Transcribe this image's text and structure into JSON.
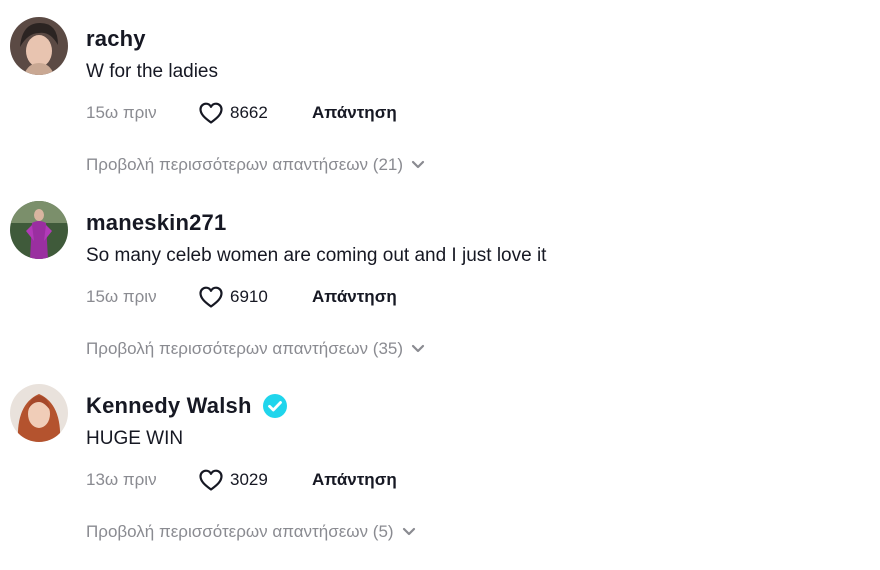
{
  "comments": [
    {
      "username": "rachy",
      "text": "W for the ladies",
      "time": "15ω πριν",
      "likes": "8662",
      "reply_label": "Απάντηση",
      "view_replies": "Προβολή περισσότερων απαντήσεων (21)",
      "verified": false
    },
    {
      "username": "maneskin271",
      "text": "So many celeb women are coming out and I just love it",
      "time": "15ω πριν",
      "likes": "6910",
      "reply_label": "Απάντηση",
      "view_replies": "Προβολή περισσότερων απαντήσεων (35)",
      "verified": false
    },
    {
      "username": "Kennedy Walsh",
      "text": "HUGE WIN",
      "time": "13ω πριν",
      "likes": "3029",
      "reply_label": "Απάντηση",
      "view_replies": "Προβολή περισσότερων απαντήσεων (5)",
      "verified": true
    }
  ],
  "icons": {
    "like": "heart-outline-icon",
    "expand": "chevron-down-icon",
    "verified": "verified-badge-icon"
  },
  "colors": {
    "text": "#161823",
    "muted": "#8a8b91",
    "verified": "#20d5ec"
  }
}
